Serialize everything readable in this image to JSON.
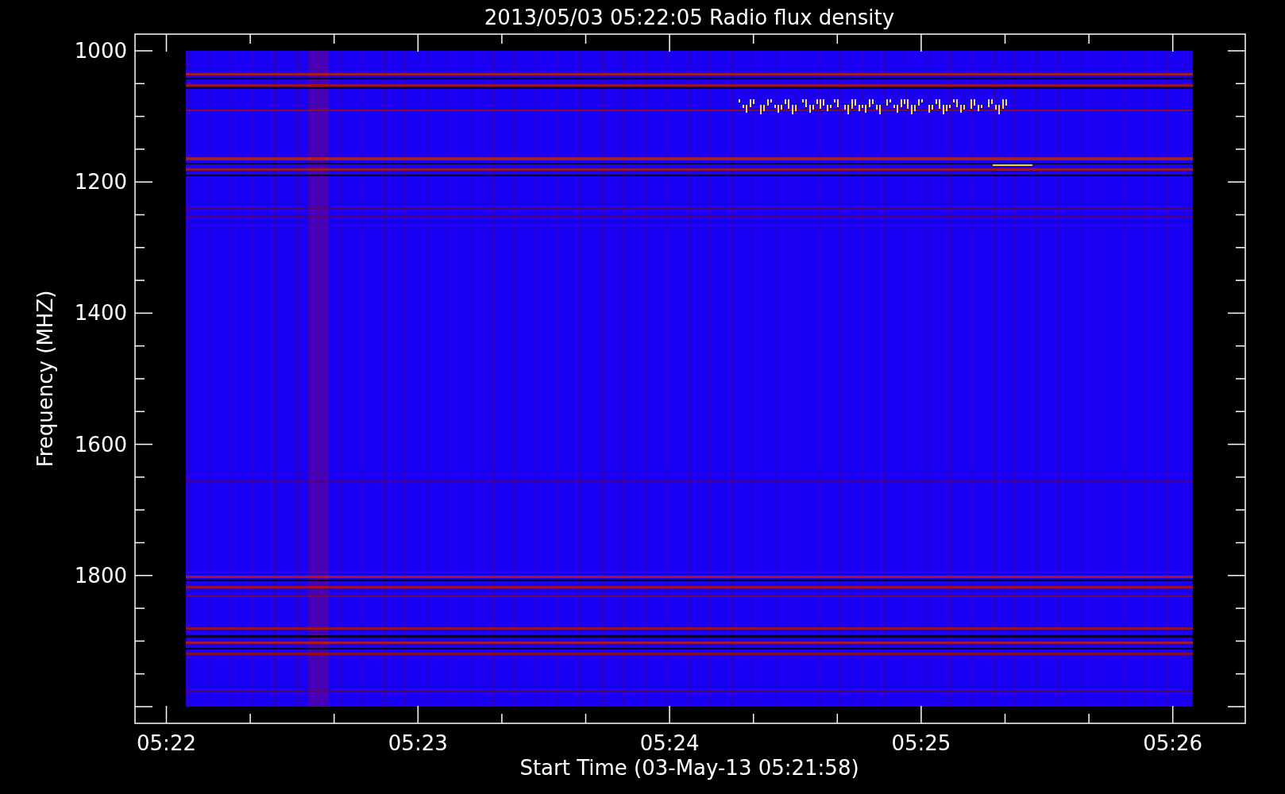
{
  "title": "2013/05/03 05:22:05 Radio flux density",
  "y_axis": {
    "label": "Frequency (MHZ)",
    "ticks": [
      "1000",
      "1200",
      "1400",
      "1600",
      "1800"
    ]
  },
  "x_axis": {
    "label": "Start Time (03-May-13 05:21:58)",
    "ticks": [
      "05:22",
      "05:23",
      "05:24",
      "05:25",
      "05:26"
    ]
  }
}
